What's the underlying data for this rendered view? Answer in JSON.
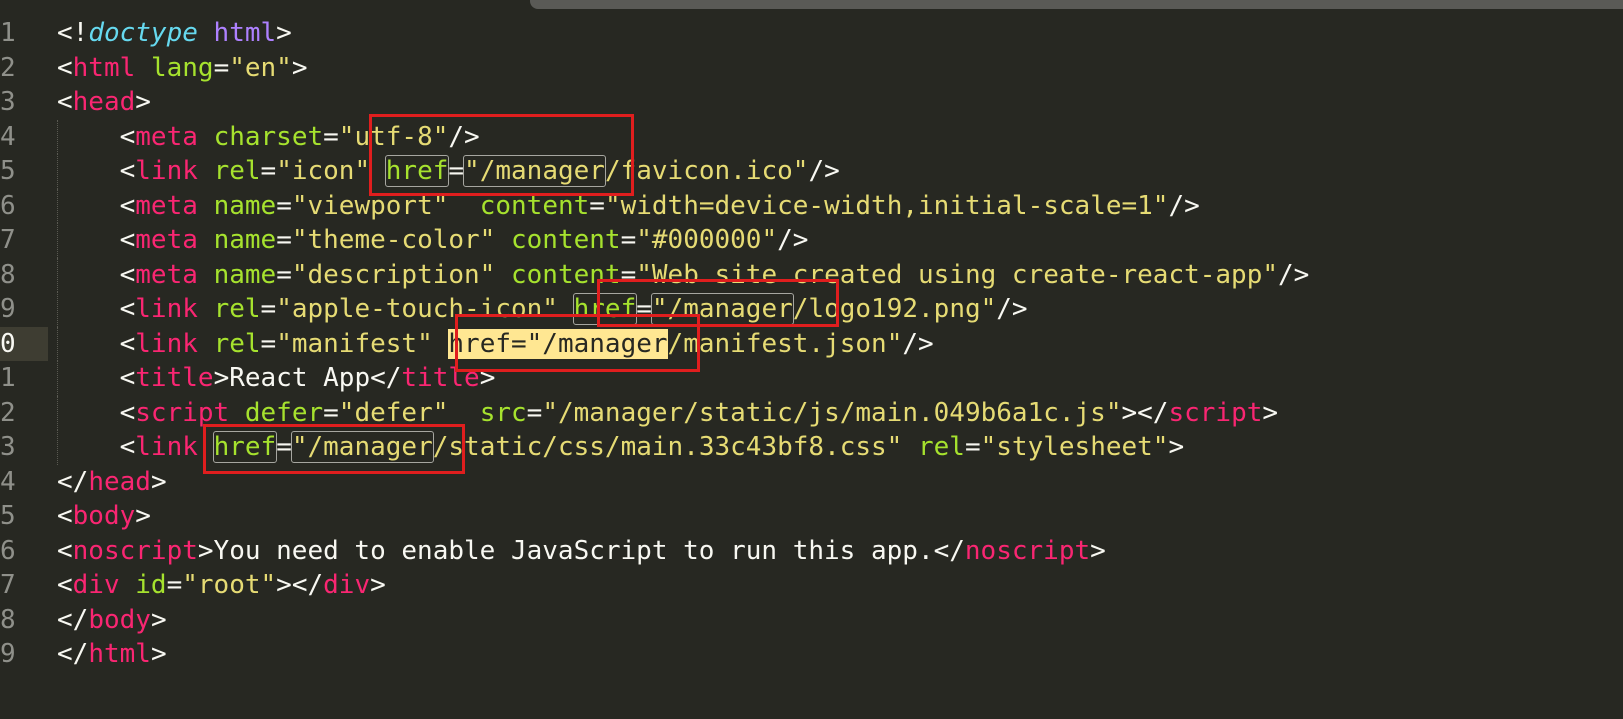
{
  "editor": {
    "theme_colors": {
      "background": "#272822",
      "tag": "#f92672",
      "attribute": "#a6e22e",
      "string": "#e6db74",
      "keyword": "#66d9ef",
      "annotation": "#e01e1e",
      "selection_highlight": "#ffe792"
    },
    "gutter": [
      "1",
      "2",
      "3",
      "4",
      "5",
      "6",
      "7",
      "8",
      "9",
      "0",
      "1",
      "2",
      "3",
      "4",
      "5",
      "6",
      "7",
      "8",
      "9"
    ],
    "current_line_index": 9,
    "lines": [
      [
        [
          "p",
          "<!"
        ],
        [
          "k",
          "doctype"
        ],
        [
          "p",
          " "
        ],
        [
          "d",
          "html"
        ],
        [
          "p",
          ">"
        ]
      ],
      [
        [
          "p",
          "<"
        ],
        [
          "t",
          "html"
        ],
        [
          "p",
          " "
        ],
        [
          "a",
          "lang"
        ],
        [
          "p",
          "="
        ],
        [
          "s",
          "\"en\""
        ],
        [
          "p",
          ">"
        ]
      ],
      [
        [
          "p",
          "<"
        ],
        [
          "t",
          "head"
        ],
        [
          "p",
          ">"
        ]
      ],
      [
        [
          "p",
          "    <"
        ],
        [
          "t",
          "meta"
        ],
        [
          "p",
          " "
        ],
        [
          "a",
          "charset"
        ],
        [
          "p",
          "="
        ],
        [
          "s",
          "\"utf-8\""
        ],
        [
          "p",
          "/>"
        ]
      ],
      [
        [
          "p",
          "    <"
        ],
        [
          "t",
          "link"
        ],
        [
          "p",
          " "
        ],
        [
          "a",
          "rel"
        ],
        [
          "p",
          "="
        ],
        [
          "s",
          "\"icon\""
        ],
        [
          "p",
          " "
        ],
        [
          "ab",
          "href"
        ],
        [
          "pb",
          "="
        ],
        [
          "sb",
          "\"/manager"
        ],
        [
          "s",
          "/favicon.ico\""
        ],
        [
          "p",
          "/>"
        ]
      ],
      [
        [
          "p",
          "    <"
        ],
        [
          "t",
          "meta"
        ],
        [
          "p",
          " "
        ],
        [
          "a",
          "name"
        ],
        [
          "p",
          "="
        ],
        [
          "s",
          "\"viewport\""
        ],
        [
          "p",
          "  "
        ],
        [
          "a",
          "content"
        ],
        [
          "p",
          "="
        ],
        [
          "s",
          "\"width=device-width,initial-scale=1\""
        ],
        [
          "p",
          "/>"
        ]
      ],
      [
        [
          "p",
          "    <"
        ],
        [
          "t",
          "meta"
        ],
        [
          "p",
          " "
        ],
        [
          "a",
          "name"
        ],
        [
          "p",
          "="
        ],
        [
          "s",
          "\"theme-color\""
        ],
        [
          "p",
          " "
        ],
        [
          "a",
          "content"
        ],
        [
          "p",
          "="
        ],
        [
          "s",
          "\"#000000\""
        ],
        [
          "p",
          "/>"
        ]
      ],
      [
        [
          "p",
          "    <"
        ],
        [
          "t",
          "meta"
        ],
        [
          "p",
          " "
        ],
        [
          "a",
          "name"
        ],
        [
          "p",
          "="
        ],
        [
          "s",
          "\"description\""
        ],
        [
          "p",
          " "
        ],
        [
          "a",
          "content"
        ],
        [
          "p",
          "="
        ],
        [
          "s",
          "\"Web site created using create-react-app\""
        ],
        [
          "p",
          "/>"
        ]
      ],
      [
        [
          "p",
          "    <"
        ],
        [
          "t",
          "link"
        ],
        [
          "p",
          " "
        ],
        [
          "a",
          "rel"
        ],
        [
          "p",
          "="
        ],
        [
          "s",
          "\"apple-touch-icon\""
        ],
        [
          "p",
          " "
        ],
        [
          "ab",
          "href"
        ],
        [
          "pb",
          "="
        ],
        [
          "sb",
          "\"/manager"
        ],
        [
          "s",
          "/logo192.png\""
        ],
        [
          "p",
          "/>"
        ]
      ],
      [
        [
          "p",
          "    <"
        ],
        [
          "t",
          "link"
        ],
        [
          "p",
          " "
        ],
        [
          "a",
          "rel"
        ],
        [
          "p",
          "="
        ],
        [
          "s",
          "\"manifest\""
        ],
        [
          "p",
          " "
        ],
        [
          "h",
          "href=\"/manager"
        ],
        [
          "s",
          "/manifest.json\""
        ],
        [
          "p",
          "/>"
        ]
      ],
      [
        [
          "p",
          "    <"
        ],
        [
          "t",
          "title"
        ],
        [
          "p",
          ">React App</"
        ],
        [
          "t",
          "title"
        ],
        [
          "p",
          ">"
        ]
      ],
      [
        [
          "p",
          "    <"
        ],
        [
          "t",
          "script"
        ],
        [
          "p",
          " "
        ],
        [
          "a",
          "defer"
        ],
        [
          "p",
          "="
        ],
        [
          "s",
          "\"defer\""
        ],
        [
          "p",
          "  "
        ],
        [
          "a",
          "src"
        ],
        [
          "p",
          "="
        ],
        [
          "s",
          "\"/manager/static/js/main.049b6a1c.js\""
        ],
        [
          "p",
          "></"
        ],
        [
          "t",
          "script"
        ],
        [
          "p",
          ">"
        ]
      ],
      [
        [
          "p",
          "    <"
        ],
        [
          "t",
          "link"
        ],
        [
          "p",
          " "
        ],
        [
          "ab",
          "href"
        ],
        [
          "pb",
          "="
        ],
        [
          "sb",
          "\"/manager"
        ],
        [
          "s",
          "/static/css/main.33c43bf8.css\""
        ],
        [
          "p",
          " "
        ],
        [
          "a",
          "rel"
        ],
        [
          "p",
          "="
        ],
        [
          "s",
          "\"stylesheet\""
        ],
        [
          "p",
          ">"
        ]
      ],
      [
        [
          "p",
          "</"
        ],
        [
          "t",
          "head"
        ],
        [
          "p",
          ">"
        ]
      ],
      [
        [
          "p",
          "<"
        ],
        [
          "t",
          "body"
        ],
        [
          "p",
          ">"
        ]
      ],
      [
        [
          "p",
          "<"
        ],
        [
          "t",
          "noscript"
        ],
        [
          "p",
          ">You need to enable JavaScript to run this app.</"
        ],
        [
          "t",
          "noscript"
        ],
        [
          "p",
          ">"
        ]
      ],
      [
        [
          "p",
          "<"
        ],
        [
          "t",
          "div"
        ],
        [
          "p",
          " "
        ],
        [
          "a",
          "id"
        ],
        [
          "p",
          "="
        ],
        [
          "s",
          "\"root\""
        ],
        [
          "p",
          "></"
        ],
        [
          "t",
          "div"
        ],
        [
          "p",
          ">"
        ]
      ],
      [
        [
          "p",
          "</"
        ],
        [
          "t",
          "body"
        ],
        [
          "p",
          ">"
        ]
      ],
      [
        [
          "p",
          "</"
        ],
        [
          "t",
          "html"
        ],
        [
          "p",
          ">"
        ]
      ]
    ]
  }
}
